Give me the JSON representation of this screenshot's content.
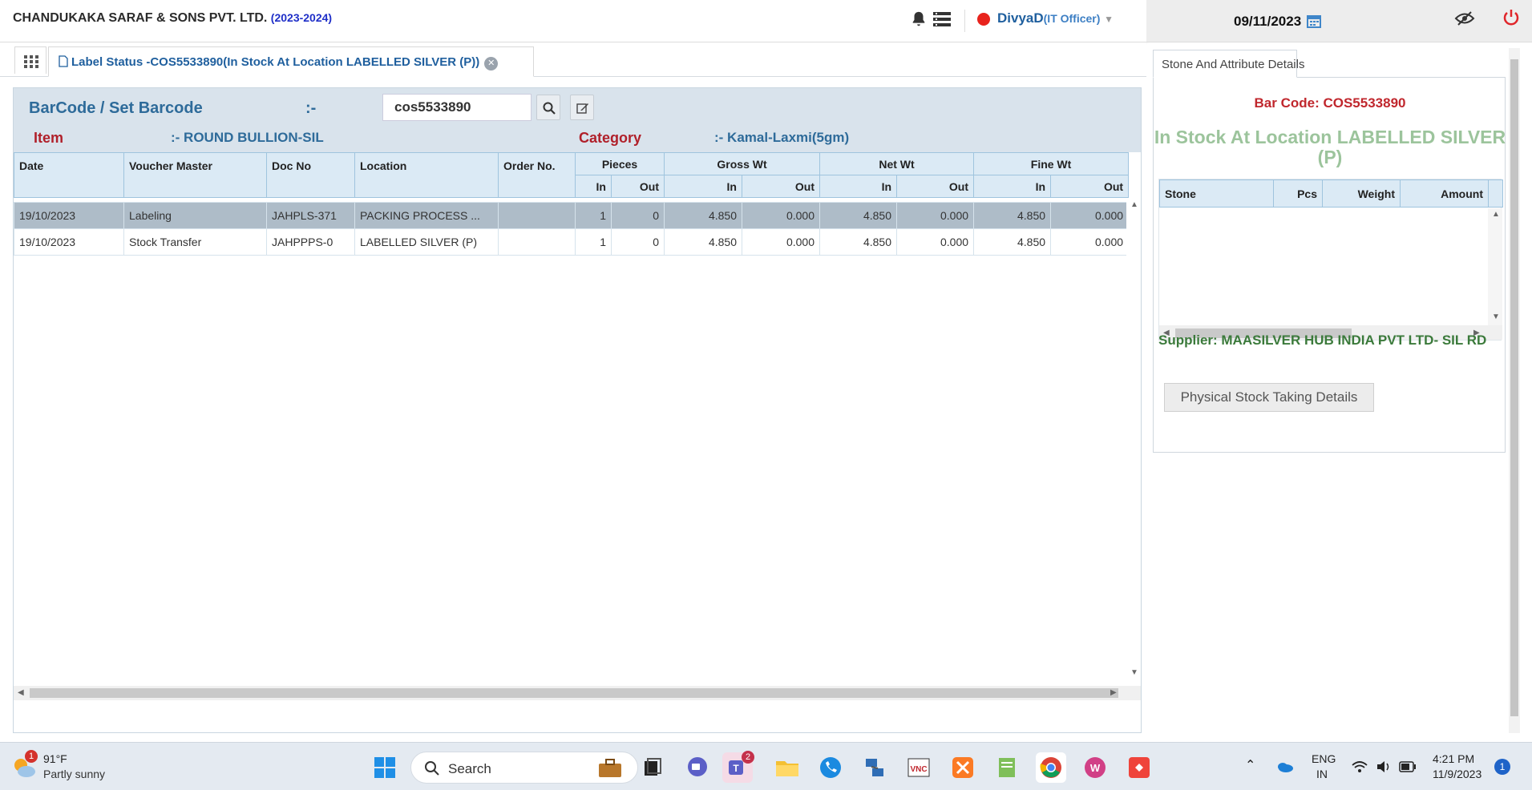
{
  "header": {
    "company": "CHANDUKAKA SARAF & SONS PVT. LTD.",
    "year": "(2023-2024)",
    "user_name": "DivyaD",
    "user_role": "(IT Officer)",
    "date": "09/11/2023"
  },
  "tab": {
    "title": "Label Status -COS5533890(In Stock At Location LABELLED SILVER (P))"
  },
  "barcode": {
    "label": "BarCode / Set Barcode",
    "colon": ":-",
    "value": "cos5533890"
  },
  "item": {
    "label": "Item",
    "value": ":- ROUND BULLION-SIL",
    "category_label": "Category",
    "category_value": ":- Kamal-Laxmi(5gm)"
  },
  "table": {
    "headers": {
      "date": "Date",
      "voucher": "Voucher Master",
      "docno": "Doc No",
      "location": "Location",
      "order": "Order No.",
      "pieces": "Pieces",
      "gross": "Gross Wt",
      "net": "Net Wt",
      "fine": "Fine Wt",
      "in": "In",
      "out": "Out"
    },
    "rows": [
      {
        "date": "19/10/2023",
        "voucher": "Labeling",
        "docno": "JAHPLS-371",
        "location": "PACKING PROCESS ...",
        "order": "",
        "pcs_in": "1",
        "pcs_out": "0",
        "gross_in": "4.850",
        "gross_out": "0.000",
        "net_in": "4.850",
        "net_out": "0.000",
        "fine_in": "4.850",
        "fine_out": "0.000"
      },
      {
        "date": "19/10/2023",
        "voucher": "Stock Transfer",
        "docno": "JAHPPPS-0",
        "location": "LABELLED SILVER (P)",
        "order": "",
        "pcs_in": "1",
        "pcs_out": "0",
        "gross_in": "4.850",
        "gross_out": "0.000",
        "net_in": "4.850",
        "net_out": "0.000",
        "fine_in": "4.850",
        "fine_out": "0.000"
      }
    ]
  },
  "details": {
    "tab_title": "Stone And Attribute Details",
    "barcode": "Bar Code: COS5533890",
    "location": "In Stock At Location LABELLED SILVER (P)",
    "stone_headers": {
      "stone": "Stone",
      "pcs": "Pcs",
      "weight": "Weight",
      "amount": "Amount"
    },
    "supplier": "Supplier: MAASILVER HUB INDIA PVT LTD- SIL RD",
    "button": "Physical Stock Taking Details"
  },
  "taskbar": {
    "weather_temp": "91°F",
    "weather_desc": "Partly sunny",
    "weather_badge": "1",
    "search": "Search",
    "teams_badge": "2",
    "lang1": "ENG",
    "lang2": "IN",
    "time": "4:21 PM",
    "date": "11/9/2023",
    "notif": "1"
  }
}
